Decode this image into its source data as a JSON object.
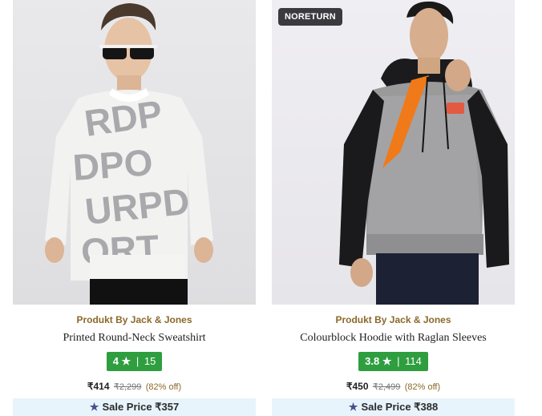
{
  "products": [
    {
      "brand": "Produkt By Jack & Jones",
      "name": "Printed Round-Neck Sweatshirt",
      "rating": "4",
      "rating_star": "★",
      "rating_sep": "|",
      "rating_count": "15",
      "price": "₹414",
      "mrp": "₹2,299",
      "discount": "(82% off)",
      "sale_star": "★",
      "sale_label": "Sale Price ₹357",
      "badge": ""
    },
    {
      "brand": "Produkt By Jack & Jones",
      "name": "Colourblock Hoodie with Raglan Sleeves",
      "rating": "3.8",
      "rating_star": "★",
      "rating_sep": "|",
      "rating_count": "114",
      "price": "₹450",
      "mrp": "₹2,499",
      "discount": "(82% off)",
      "sale_star": "★",
      "sale_label": "Sale Price ₹388",
      "badge": "NORETURN"
    }
  ],
  "colors": {
    "rating_bg": "#2e9e3f",
    "brand_text": "#8a6a2a",
    "sale_bar_bg": "#e8f4fb",
    "badge_bg": "#3b3b3f",
    "sale_star": "#4a4d8c"
  },
  "icons": {
    "rating": "star-icon",
    "sale": "star-icon"
  }
}
